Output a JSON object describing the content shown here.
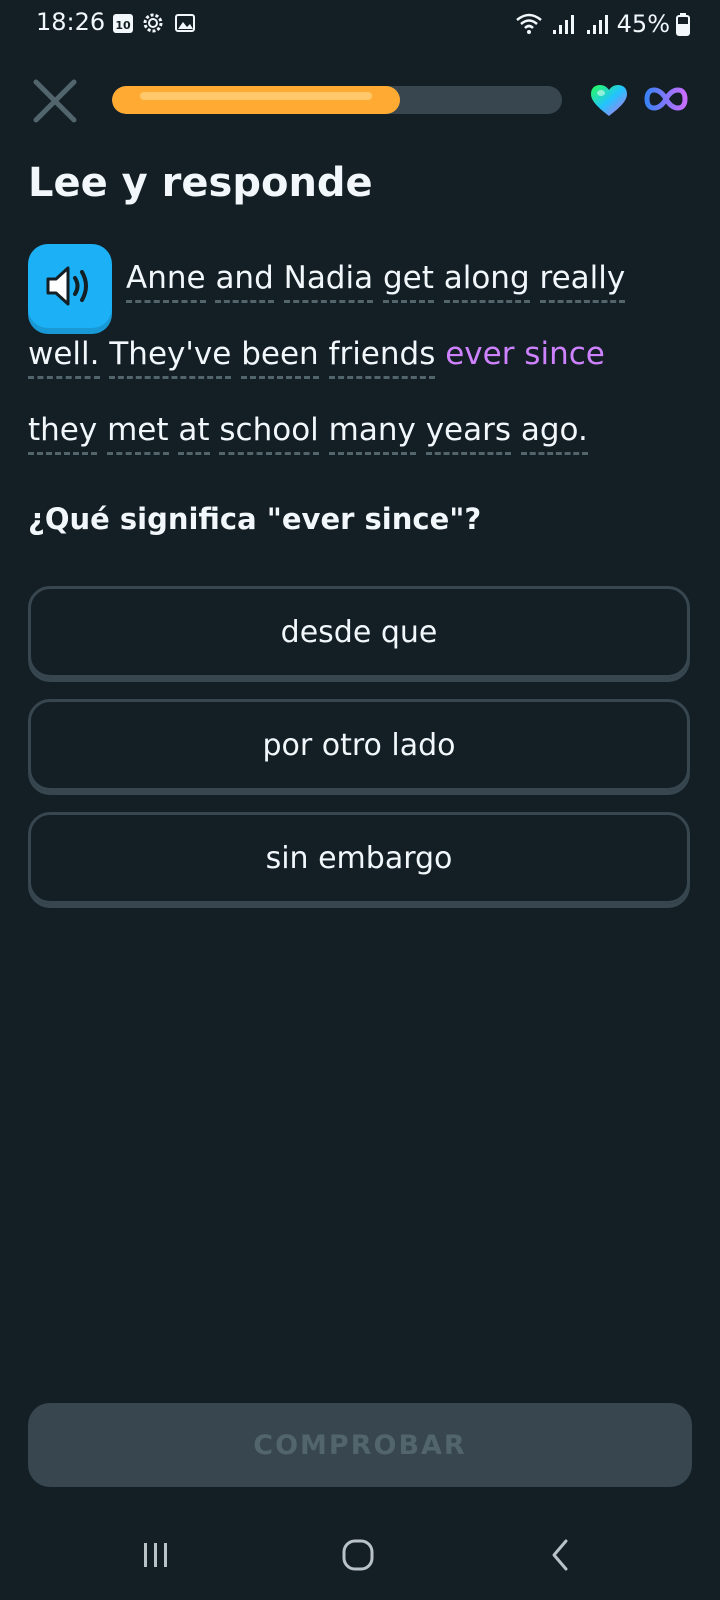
{
  "status_bar": {
    "time": "18:26",
    "calendar_day": "10",
    "battery": "45%",
    "icons": [
      "calendar-icon",
      "settings-icon",
      "gallery-icon",
      "wifi-icon",
      "signal-icon",
      "battery-icon"
    ]
  },
  "header": {
    "progress_fraction": 0.64,
    "icons": [
      "close-icon",
      "heart-icon",
      "infinity-icon"
    ]
  },
  "exercise": {
    "title": "Lee y responde",
    "passage": {
      "line1": [
        "Anne",
        "and",
        "Nadia",
        "get",
        "along",
        "really"
      ],
      "line2_words": [
        "well.",
        "They've",
        "been",
        "friends"
      ],
      "highlight": "ever since",
      "line3": [
        "they",
        "met",
        "at",
        "school",
        "many",
        "years",
        "ago."
      ]
    },
    "question": "¿Qué significa \"ever since\"?",
    "options": [
      "desde que",
      "por otro lado",
      "sin embargo"
    ]
  },
  "footer": {
    "check_label": "COMPROBAR"
  },
  "colors": {
    "background": "#131f24",
    "accent_orange": "#ffab33",
    "highlight_purple": "#ce82ff",
    "speaker_blue": "#1cb0f6",
    "border_gray": "#37464f"
  }
}
